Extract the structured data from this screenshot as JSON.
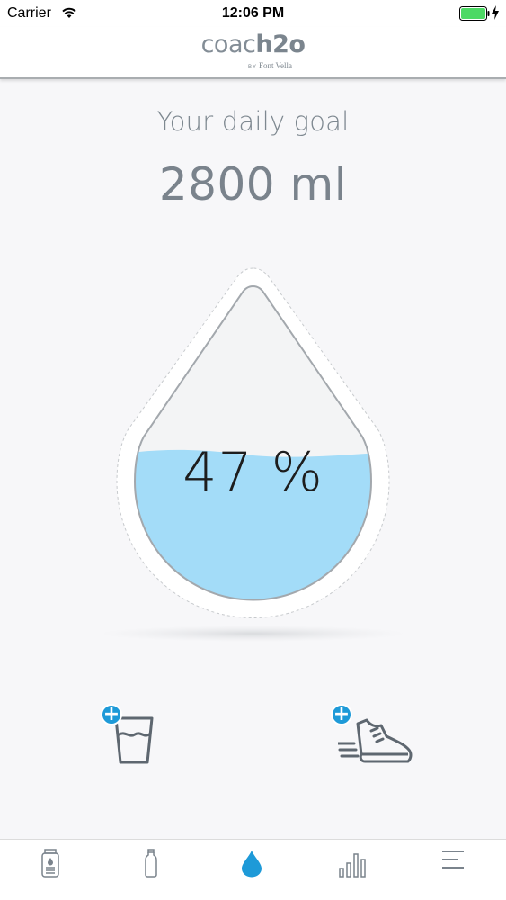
{
  "status_bar": {
    "carrier": "Carrier",
    "time": "12:06 PM",
    "battery_color": "#4cd964"
  },
  "header": {
    "logo_light": "coac",
    "logo_bold": "h2o",
    "logo_by": "BY",
    "logo_brand": "Font Vella"
  },
  "goal": {
    "label": "Your daily goal",
    "value": "2800 ml"
  },
  "progress": {
    "fraction": 0.47,
    "label": "47 %",
    "water_color": "#a3dcf8"
  },
  "actions": {
    "add_water_icon": "glass-icon",
    "add_activity_icon": "sneaker-icon",
    "accent_color": "#1e9ad8"
  },
  "tab_bar": {
    "items": [
      {
        "icon": "bottle-label-icon",
        "active": false
      },
      {
        "icon": "bottle-icon",
        "active": false
      },
      {
        "icon": "water-drop-icon",
        "active": true
      },
      {
        "icon": "bar-chart-icon",
        "active": false
      },
      {
        "icon": "menu-icon",
        "active": false
      }
    ],
    "active_color": "#1e9ad8",
    "inactive_color": "#7a838c"
  }
}
